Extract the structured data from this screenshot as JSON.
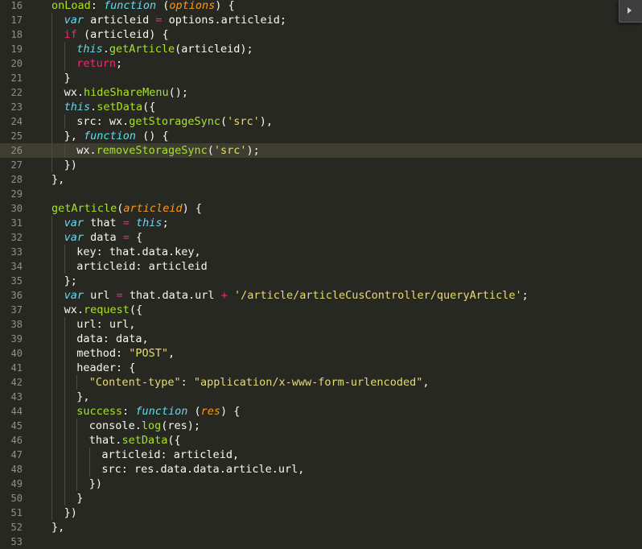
{
  "editor": {
    "colors": {
      "background": "#272822",
      "text": "#f8f8f2",
      "keyword": "#66d9ef",
      "string": "#e6db74",
      "function": "#a6e22e",
      "param": "#fd971f",
      "operator": "#f92672",
      "punct": "#f8f8f2",
      "comment": "#75715e",
      "line_number": "#90908a"
    },
    "current_line": 26,
    "lines": [
      {
        "n": "16",
        "indent": 1,
        "tokens": [
          [
            "onLoad",
            "fn"
          ],
          [
            ": ",
            "p"
          ],
          [
            "function",
            "kw"
          ],
          [
            " (",
            "p"
          ],
          [
            "options",
            "pa"
          ],
          [
            ") {",
            "p"
          ]
        ]
      },
      {
        "n": "17",
        "indent": 2,
        "tokens": [
          [
            "var",
            "kw"
          ],
          [
            " articleid ",
            "t"
          ],
          [
            "=",
            "op"
          ],
          [
            " options.articleid;",
            "t"
          ]
        ]
      },
      {
        "n": "18",
        "indent": 2,
        "tokens": [
          [
            "if",
            "op"
          ],
          [
            " (articleid) {",
            "t"
          ]
        ]
      },
      {
        "n": "19",
        "indent": 3,
        "tokens": [
          [
            "this",
            "kw"
          ],
          [
            ".",
            "t"
          ],
          [
            "getArticle",
            "fn"
          ],
          [
            "(articleid);",
            "t"
          ]
        ]
      },
      {
        "n": "20",
        "indent": 3,
        "tokens": [
          [
            "return",
            "op"
          ],
          [
            ";",
            "t"
          ]
        ]
      },
      {
        "n": "21",
        "indent": 2,
        "tokens": [
          [
            "}",
            "t"
          ]
        ]
      },
      {
        "n": "22",
        "indent": 2,
        "tokens": [
          [
            "wx.",
            "t"
          ],
          [
            "hideShareMenu",
            "fn"
          ],
          [
            "();",
            "t"
          ]
        ]
      },
      {
        "n": "23",
        "indent": 2,
        "tokens": [
          [
            "this",
            "kw"
          ],
          [
            ".",
            "t"
          ],
          [
            "setData",
            "fn"
          ],
          [
            "({",
            "t"
          ]
        ]
      },
      {
        "n": "24",
        "indent": 3,
        "tokens": [
          [
            "src: wx.",
            "t"
          ],
          [
            "getStorageSync",
            "fn"
          ],
          [
            "(",
            "t"
          ],
          [
            "'src'",
            "st"
          ],
          [
            "),",
            "t"
          ]
        ]
      },
      {
        "n": "25",
        "indent": 2,
        "tokens": [
          [
            "}, ",
            "t"
          ],
          [
            "function",
            "kw"
          ],
          [
            " () ",
            "t"
          ],
          [
            "{",
            "t"
          ]
        ]
      },
      {
        "n": "26",
        "indent": 3,
        "tokens": [
          [
            "wx.",
            "t"
          ],
          [
            "removeStorageSync",
            "fn"
          ],
          [
            "(",
            "t"
          ],
          [
            "'src'",
            "st"
          ],
          [
            ");",
            "t"
          ]
        ]
      },
      {
        "n": "27",
        "indent": 2,
        "tokens": [
          [
            "})",
            "t"
          ]
        ]
      },
      {
        "n": "28",
        "indent": 1,
        "tokens": [
          [
            "},",
            "t"
          ]
        ]
      },
      {
        "n": "29",
        "indent": 0,
        "tokens": []
      },
      {
        "n": "30",
        "indent": 1,
        "tokens": [
          [
            "getArticle",
            "fn"
          ],
          [
            "(",
            "t"
          ],
          [
            "articleid",
            "pa"
          ],
          [
            ") {",
            "t"
          ]
        ]
      },
      {
        "n": "31",
        "indent": 2,
        "tokens": [
          [
            "var",
            "kw"
          ],
          [
            " that ",
            "t"
          ],
          [
            "=",
            "op"
          ],
          [
            " ",
            "t"
          ],
          [
            "this",
            "kw"
          ],
          [
            ";",
            "t"
          ]
        ]
      },
      {
        "n": "32",
        "indent": 2,
        "tokens": [
          [
            "var",
            "kw"
          ],
          [
            " data ",
            "t"
          ],
          [
            "=",
            "op"
          ],
          [
            " {",
            "t"
          ]
        ]
      },
      {
        "n": "33",
        "indent": 3,
        "tokens": [
          [
            "key: that.data.key,",
            "t"
          ]
        ]
      },
      {
        "n": "34",
        "indent": 3,
        "tokens": [
          [
            "articleid: articleid",
            "t"
          ]
        ]
      },
      {
        "n": "35",
        "indent": 2,
        "tokens": [
          [
            "};",
            "t"
          ]
        ]
      },
      {
        "n": "36",
        "indent": 2,
        "tokens": [
          [
            "var",
            "kw"
          ],
          [
            " url ",
            "t"
          ],
          [
            "=",
            "op"
          ],
          [
            " that.data.url ",
            "t"
          ],
          [
            "+",
            "op"
          ],
          [
            " ",
            "t"
          ],
          [
            "'/article/articleCusController/queryArticle'",
            "st"
          ],
          [
            ";",
            "t"
          ]
        ]
      },
      {
        "n": "37",
        "indent": 2,
        "tokens": [
          [
            "wx.",
            "t"
          ],
          [
            "request",
            "fn"
          ],
          [
            "({",
            "t"
          ]
        ]
      },
      {
        "n": "38",
        "indent": 3,
        "tokens": [
          [
            "url: url,",
            "t"
          ]
        ]
      },
      {
        "n": "39",
        "indent": 3,
        "tokens": [
          [
            "data: data,",
            "t"
          ]
        ]
      },
      {
        "n": "40",
        "indent": 3,
        "tokens": [
          [
            "method: ",
            "t"
          ],
          [
            "\"POST\"",
            "st"
          ],
          [
            ",",
            "t"
          ]
        ]
      },
      {
        "n": "41",
        "indent": 3,
        "tokens": [
          [
            "header: {",
            "t"
          ]
        ]
      },
      {
        "n": "42",
        "indent": 4,
        "tokens": [
          [
            "\"Content-type\"",
            "st"
          ],
          [
            ": ",
            "t"
          ],
          [
            "\"application/x-www-form-urlencoded\"",
            "st"
          ],
          [
            ",",
            "t"
          ]
        ]
      },
      {
        "n": "43",
        "indent": 3,
        "tokens": [
          [
            "},",
            "t"
          ]
        ]
      },
      {
        "n": "44",
        "indent": 3,
        "tokens": [
          [
            "success",
            "fn"
          ],
          [
            ": ",
            "t"
          ],
          [
            "function",
            "kw"
          ],
          [
            " (",
            "t"
          ],
          [
            "res",
            "pa"
          ],
          [
            ") {",
            "t"
          ]
        ]
      },
      {
        "n": "45",
        "indent": 4,
        "tokens": [
          [
            "console.",
            "t"
          ],
          [
            "log",
            "fn"
          ],
          [
            "(res);",
            "t"
          ]
        ]
      },
      {
        "n": "46",
        "indent": 4,
        "tokens": [
          [
            "that.",
            "t"
          ],
          [
            "setData",
            "fn"
          ],
          [
            "({",
            "t"
          ]
        ]
      },
      {
        "n": "47",
        "indent": 5,
        "tokens": [
          [
            "articleid: articleid,",
            "t"
          ]
        ]
      },
      {
        "n": "48",
        "indent": 5,
        "tokens": [
          [
            "src: res.data.data.article.url,",
            "t"
          ]
        ]
      },
      {
        "n": "49",
        "indent": 4,
        "tokens": [
          [
            "})",
            "t"
          ]
        ]
      },
      {
        "n": "50",
        "indent": 3,
        "tokens": [
          [
            "}",
            "t"
          ]
        ]
      },
      {
        "n": "51",
        "indent": 2,
        "tokens": [
          [
            "})",
            "t"
          ]
        ]
      },
      {
        "n": "52",
        "indent": 1,
        "tokens": [
          [
            "},",
            "t"
          ]
        ]
      },
      {
        "n": "53",
        "indent": 0,
        "tokens": []
      }
    ]
  }
}
